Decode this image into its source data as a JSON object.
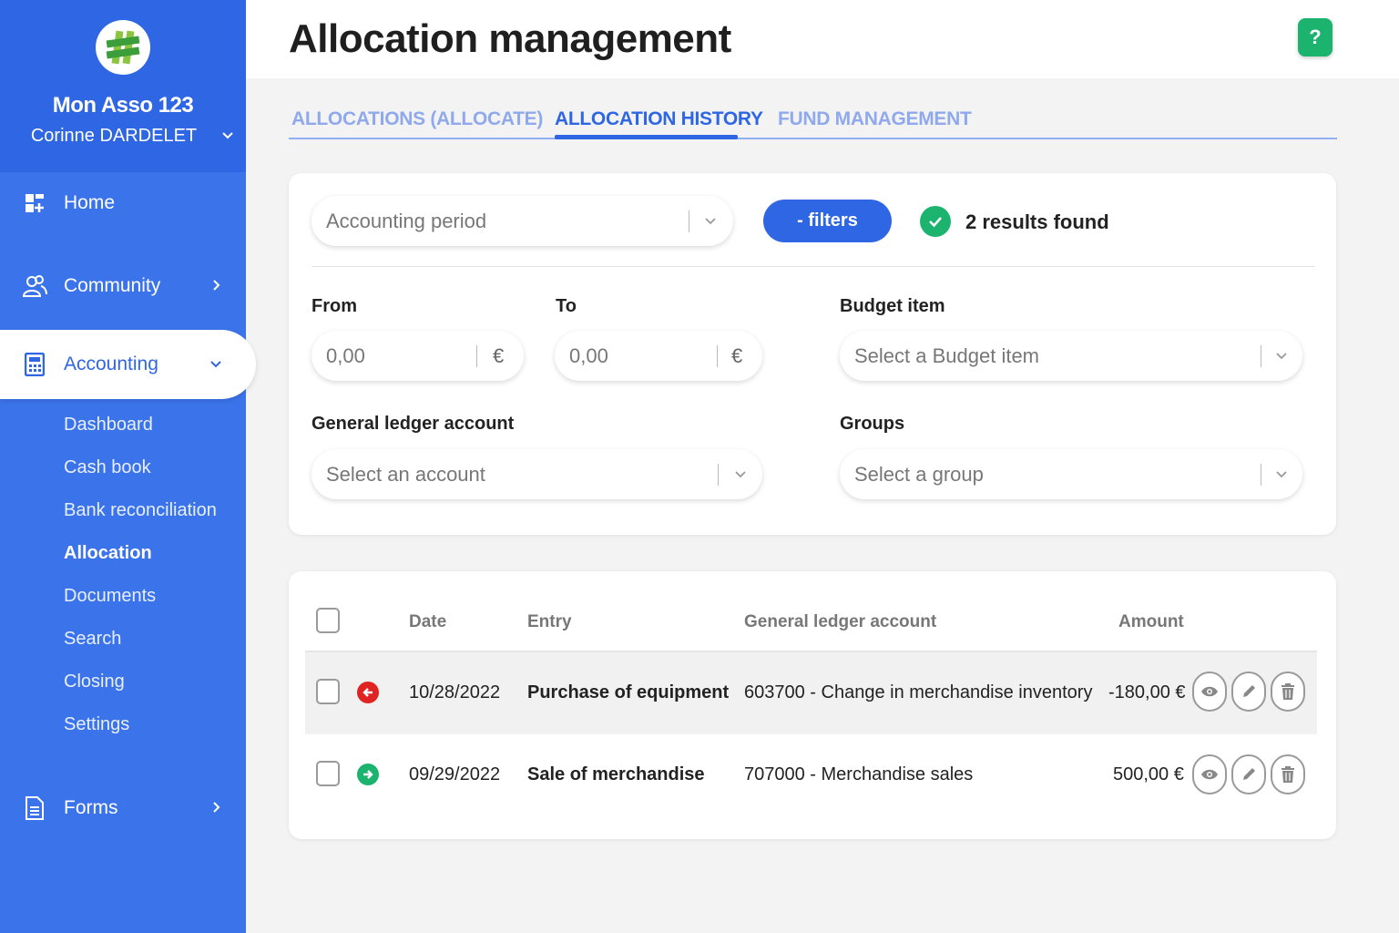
{
  "org": {
    "name": "Mon Asso 123",
    "user": "Corinne DARDELET"
  },
  "nav": {
    "home": "Home",
    "community": "Community",
    "accounting": "Accounting",
    "forms": "Forms"
  },
  "subnav": {
    "dashboard": "Dashboard",
    "cash_book": "Cash book",
    "bank_reconciliation": "Bank reconciliation",
    "allocation": "Allocation",
    "documents": "Documents",
    "search": "Search",
    "closing": "Closing",
    "settings": "Settings"
  },
  "header": {
    "title": "Allocation management",
    "help": "?"
  },
  "tabs": {
    "allocations": "ALLOCATIONS (ALLOCATE)",
    "history": "ALLOCATION HISTORY",
    "funds": "FUND MANAGEMENT"
  },
  "filters": {
    "accounting_period_placeholder": "Accounting period",
    "filters_button": "- filters",
    "results": "2 results found",
    "from_label": "From",
    "from_value": "0,00",
    "to_label": "To",
    "to_value": "0,00",
    "currency": "€",
    "budget_label": "Budget item",
    "budget_placeholder": "Select a Budget item",
    "gla_label": "General ledger account",
    "gla_placeholder": "Select an account",
    "groups_label": "Groups",
    "groups_placeholder": "Select a group"
  },
  "table": {
    "columns": {
      "date": "Date",
      "entry": "Entry",
      "account": "General ledger account",
      "amount": "Amount"
    },
    "rows": [
      {
        "direction": "outgoing",
        "date": "10/28/2022",
        "entry": "Purchase of equipment",
        "account": "603700 - Change in merchandise inventory",
        "amount": "-180,00 €"
      },
      {
        "direction": "incoming",
        "date": "09/29/2022",
        "entry": "Sale of merchandise",
        "account": "707000 - Merchandise sales",
        "amount": "500,00 €"
      }
    ]
  },
  "colors": {
    "primary": "#2f66e4",
    "sidebar": "#3b73ea",
    "success": "#1bb36e",
    "danger": "#e02424"
  }
}
